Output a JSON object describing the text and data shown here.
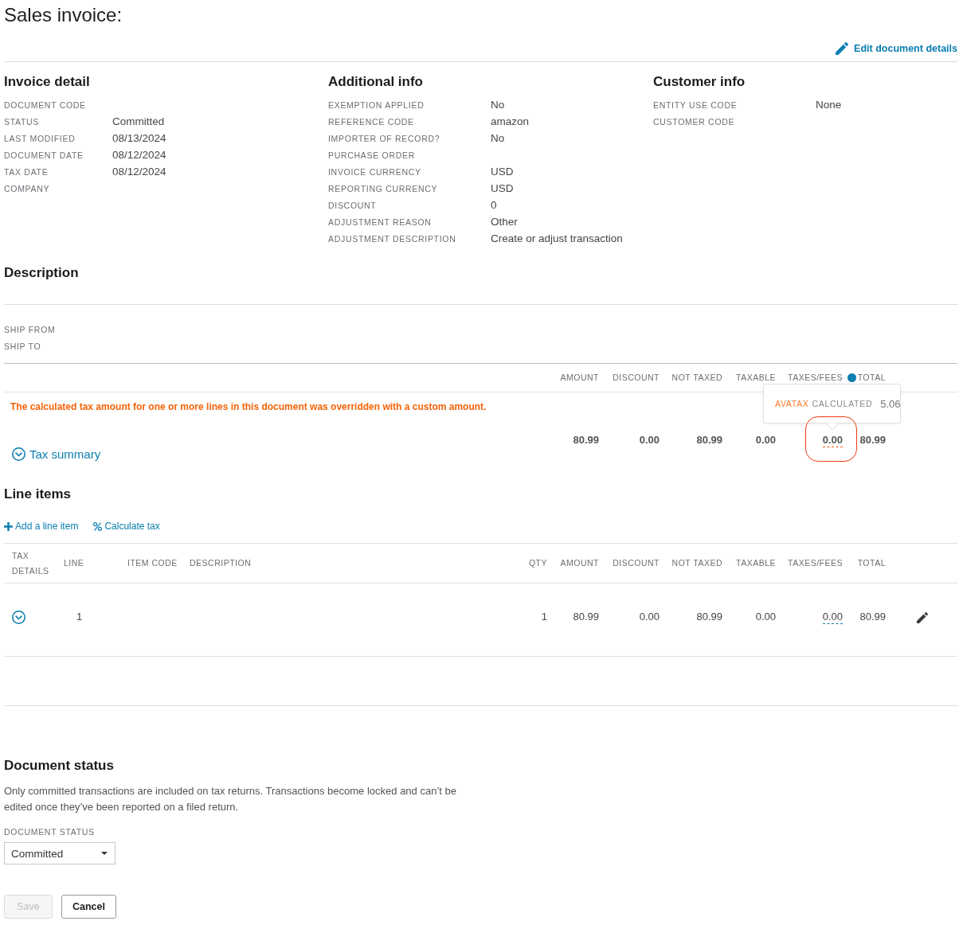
{
  "header": {
    "title": "Sales invoice:",
    "edit_link": "Edit document details"
  },
  "info_sections": [
    {
      "heading": "Invoice detail",
      "fields": [
        {
          "label": "DOCUMENT CODE"
        },
        {
          "label": "STATUS",
          "value": "Committed"
        },
        {
          "label": "LAST MODIFIED",
          "value": "08/13/2024"
        },
        {
          "label": "DOCUMENT DATE",
          "value": "08/12/2024"
        },
        {
          "label": "TAX DATE",
          "value": "08/12/2024"
        },
        {
          "label": "COMPANY"
        }
      ]
    },
    {
      "heading": "Additional info",
      "fields": [
        {
          "label": "EXEMPTION APPLIED",
          "value": "No"
        },
        {
          "label": "REFERENCE CODE",
          "value": "amazon"
        },
        {
          "label": "IMPORTER OF RECORD?",
          "value": "No"
        },
        {
          "label": "PURCHASE ORDER"
        },
        {
          "label": "INVOICE CURRENCY",
          "value": "USD"
        },
        {
          "label": "REPORTING CURRENCY",
          "value": "USD"
        },
        {
          "label": "DISCOUNT",
          "value": "0"
        },
        {
          "label": "ADJUSTMENT REASON",
          "value": "Other"
        },
        {
          "label": "ADJUSTMENT DESCRIPTION",
          "value": "Create or adjust transaction"
        }
      ]
    },
    {
      "heading": "Customer info",
      "fields": [
        {
          "label": "ENTITY USE CODE",
          "value": "None"
        },
        {
          "label": "CUSTOMER CODE"
        }
      ]
    }
  ],
  "description": {
    "heading": "Description",
    "fields": [
      {
        "label": "SHIP FROM"
      },
      {
        "label": "SHIP TO"
      }
    ]
  },
  "totals": {
    "columns": [
      "AMOUNT",
      "DISCOUNT",
      "NOT TAXED",
      "TAXABLE",
      "TAXES/FEES",
      "TOTAL"
    ],
    "warning": "The calculated tax amount for one or more lines in this document was overridden with a custom amount.",
    "tax_summary": {
      "label": "Tax summary",
      "expanded": false
    },
    "values": [
      {
        "value": "80.99",
        "overridden": false,
        "highlighted": false
      },
      {
        "value": "0.00",
        "overridden": false,
        "highlighted": false
      },
      {
        "value": "80.99",
        "overridden": false,
        "highlighted": false
      },
      {
        "value": "0.00",
        "overridden": false,
        "highlighted": false
      },
      {
        "value": "0.00",
        "overridden": true,
        "highlighted": true
      },
      {
        "value": "80.99",
        "overridden": false,
        "highlighted": false
      }
    ],
    "tooltip": {
      "source": "AVATAX",
      "label": "CALCULATED",
      "value": "5.06"
    }
  },
  "line_items": {
    "heading": "Line items",
    "actions": [
      {
        "kind": "add",
        "label": "Add a line item"
      },
      {
        "kind": "calculate",
        "label": "Calculate tax"
      }
    ],
    "columns": [
      "TAX DETAILS",
      "LINE",
      "ITEM CODE",
      "DESCRIPTION",
      "QTY",
      "AMOUNT",
      "DISCOUNT",
      "NOT TAXED",
      "TAXABLE",
      "TAXES/FEES",
      "TOTAL"
    ],
    "rows": [
      {
        "expanded": false,
        "line": "1",
        "qty": "1",
        "amount": "80.99",
        "discount": "0.00",
        "not_taxed": "80.99",
        "taxable": "0.00",
        "taxes_fees": {
          "value": "0.00",
          "overridden": true
        },
        "total": "80.99"
      }
    ]
  },
  "document_status": {
    "heading": "Document status",
    "description": "Only committed transactions are included on tax returns. Transactions become locked and can’t be edited once they’ve been reported on a filed return.",
    "field_label": "DOCUMENT STATUS",
    "select_value": "Committed",
    "buttons": [
      {
        "label": "Save",
        "disabled": true
      },
      {
        "label": "Cancel",
        "disabled": false
      }
    ]
  }
}
